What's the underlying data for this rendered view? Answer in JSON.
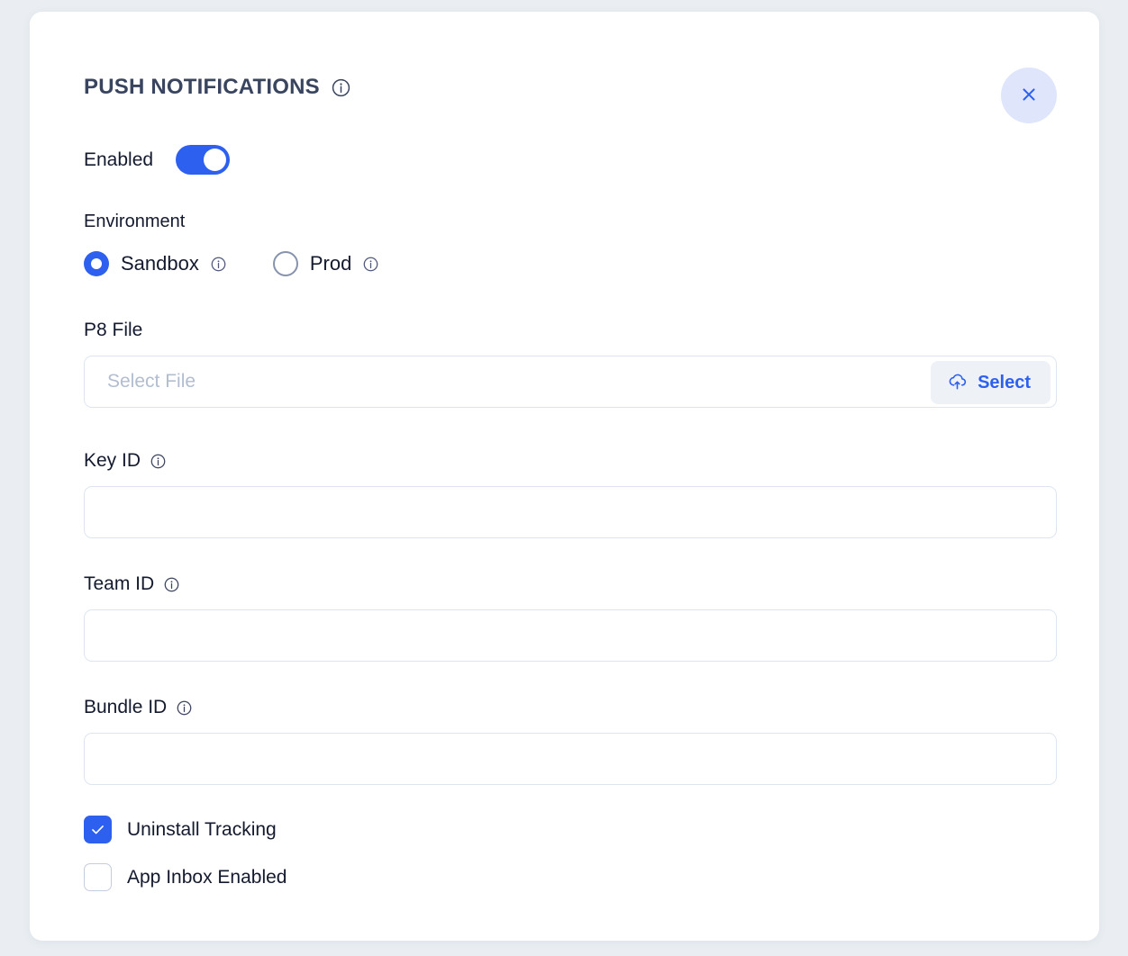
{
  "panel": {
    "title": "PUSH NOTIFICATIONS",
    "title_info_icon": "info-icon",
    "close_icon": "close-icon"
  },
  "enabled": {
    "label": "Enabled",
    "checked": true
  },
  "environment": {
    "label": "Environment",
    "options": [
      {
        "label": "Sandbox",
        "selected": true,
        "info_icon": "info-icon"
      },
      {
        "label": "Prod",
        "selected": false,
        "info_icon": "info-icon"
      }
    ]
  },
  "p8_file": {
    "label": "P8 File",
    "value": "",
    "placeholder": "Select File",
    "select_button": {
      "label": "Select",
      "icon": "cloud-upload-icon"
    }
  },
  "key_id": {
    "label": "Key ID",
    "info_icon": "info-icon",
    "value": ""
  },
  "team_id": {
    "label": "Team ID",
    "info_icon": "info-icon",
    "value": ""
  },
  "bundle_id": {
    "label": "Bundle ID",
    "info_icon": "info-icon",
    "value": ""
  },
  "checkboxes": [
    {
      "label": "Uninstall Tracking",
      "checked": true
    },
    {
      "label": "App Inbox Enabled",
      "checked": false
    }
  ],
  "colors": {
    "accent": "#2e60ef",
    "page_background": "#eaeef2",
    "card_background": "#ffffff",
    "text": "#141a2e",
    "title_text": "#39455f",
    "placeholder": "#b2bdd0",
    "close_button_background": "#dfe6fb",
    "input_border": "#dde6f0"
  }
}
